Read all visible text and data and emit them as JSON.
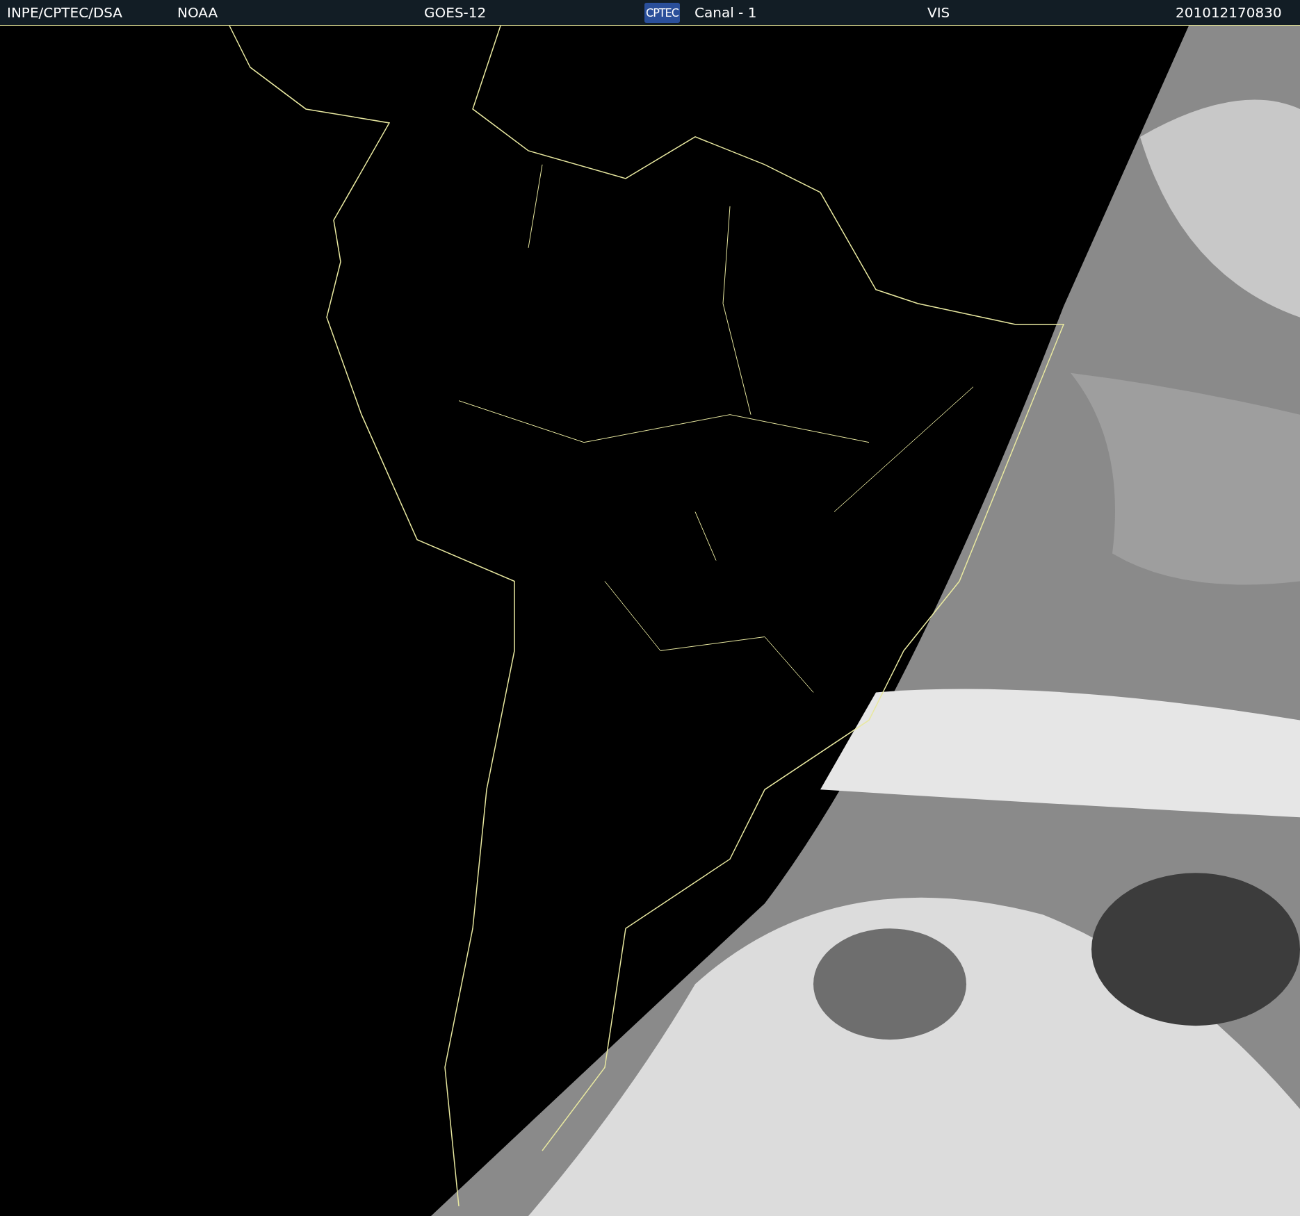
{
  "header": {
    "source": "INPE/CPTEC/DSA",
    "agency": "NOAA",
    "satellite": "GOES-12",
    "logo": "CPTEC",
    "channel": "Canal - 1",
    "band": "VIS",
    "timestamp": "201012170830"
  }
}
